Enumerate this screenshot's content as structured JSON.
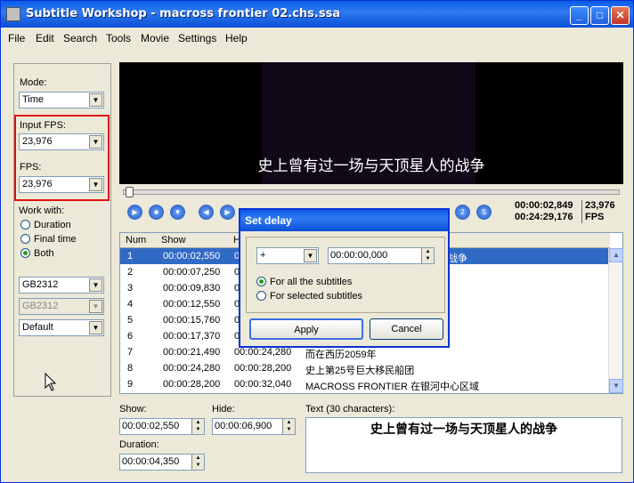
{
  "window": {
    "title": "Subtitle Workshop - macross frontier 02.chs.ssa",
    "min": "_",
    "max": "□",
    "close": "✕"
  },
  "menu": [
    "File",
    "Edit",
    "Search",
    "Tools",
    "Movie",
    "Settings",
    "Help"
  ],
  "left": {
    "mode_label": "Mode:",
    "mode_value": "Time",
    "input_fps_label": "Input FPS:",
    "input_fps_value": "23,976",
    "fps_label": "FPS:",
    "fps_value": "23,976",
    "work_with_label": "Work with:",
    "radios": [
      {
        "label": "Duration",
        "checked": false
      },
      {
        "label": "Final time",
        "checked": false
      },
      {
        "label": "Both",
        "checked": true
      }
    ],
    "charset1": "GB2312",
    "charset2": "GB2312",
    "style": "Default"
  },
  "video": {
    "subtitle": "史上曾有过一场与天顶星人的战争",
    "current_time": "00:00:02,849",
    "total_time": "00:24:29,176",
    "fps_value": "23,976",
    "fps_label": "FPS"
  },
  "grid": {
    "headers": {
      "num": "Num",
      "show": "Show",
      "hide": "H",
      "text": ""
    },
    "rows": [
      {
        "num": "1",
        "show": "00:00:02,550",
        "hide": "0",
        "text": "战争"
      },
      {
        "num": "2",
        "show": "00:00:07,250",
        "hide": "0",
        "text": ""
      },
      {
        "num": "3",
        "show": "00:00:09,830",
        "hide": "0",
        "text": ""
      },
      {
        "num": "4",
        "show": "00:00:12,550",
        "hide": "0",
        "text": ""
      },
      {
        "num": "5",
        "show": "00:00:15,760",
        "hide": "0",
        "text": ""
      },
      {
        "num": "6",
        "show": "00:00:17,370",
        "hide": "0",
        "text": ""
      },
      {
        "num": "7",
        "show": "00:00:21,490",
        "hide": "00:00:24,280",
        "text": "而在西历2059年"
      },
      {
        "num": "8",
        "show": "00:00:24,280",
        "hide": "00:00:28,200",
        "text": "史上第25号巨大移民船团"
      },
      {
        "num": "9",
        "show": "00:00:28,200",
        "hide": "00:00:32,040",
        "text": "MACROSS FRONTIER 在银河中心区域"
      }
    ]
  },
  "bottom": {
    "show_label": "Show:",
    "show_value": "00:00:02,550",
    "hide_label": "Hide:",
    "hide_value": "00:00:06,900",
    "duration_label": "Duration:",
    "duration_value": "00:00:04,350",
    "text_label": "Text (30 characters):",
    "text_value": "史上曾有过一场与天顶星人的战争"
  },
  "dialog": {
    "title": "Set delay",
    "sign_value": "+",
    "delay_value": "00:00:00,000",
    "radio_all": "For all the subtitles",
    "radio_selected": "For selected subtitles",
    "apply": "Apply",
    "cancel": "Cancel"
  }
}
